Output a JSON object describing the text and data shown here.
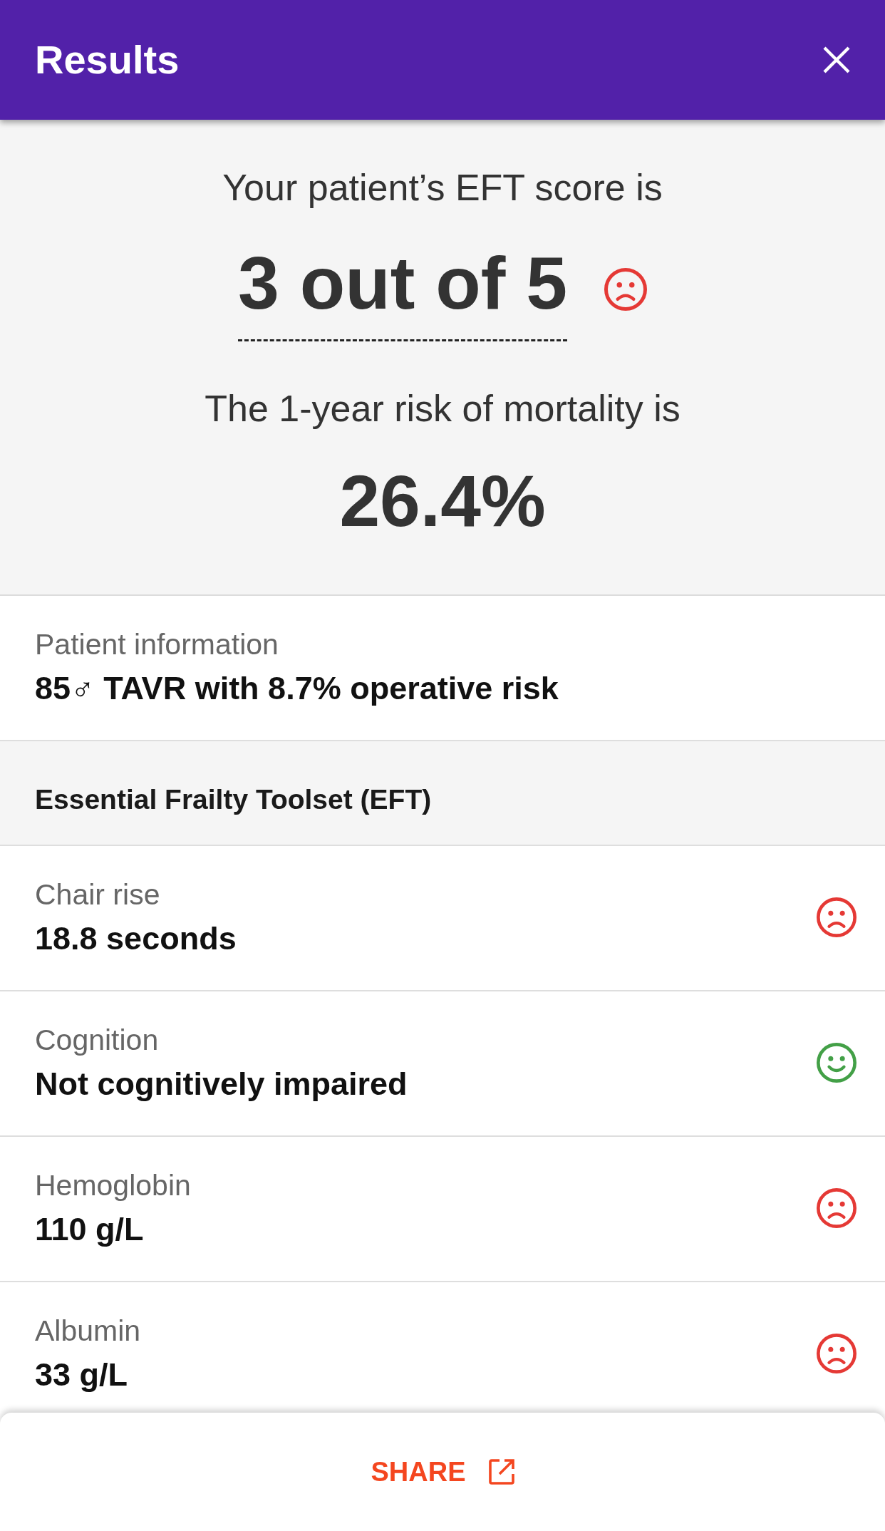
{
  "header": {
    "title": "Results"
  },
  "score": {
    "intro": "Your patient’s EFT score is",
    "value": "3 out of 5",
    "at_risk": true,
    "risk_intro": "The 1-year risk of mortality is",
    "risk_value": "26.4%"
  },
  "patient_info": {
    "label": "Patient information",
    "value": "85♂ TAVR with 8.7% operative risk"
  },
  "section": {
    "title": "Essential Frailty Toolset (EFT)"
  },
  "rows": [
    {
      "label": "Chair rise",
      "value": "18.8 seconds",
      "at_risk": true
    },
    {
      "label": "Cognition",
      "value": "Not cognitively impaired",
      "at_risk": false
    },
    {
      "label": "Hemoglobin",
      "value": "110 g/L",
      "at_risk": true
    },
    {
      "label": "Albumin",
      "value": "33 g/L",
      "at_risk": true
    }
  ],
  "footer": {
    "button": "SHARE"
  }
}
